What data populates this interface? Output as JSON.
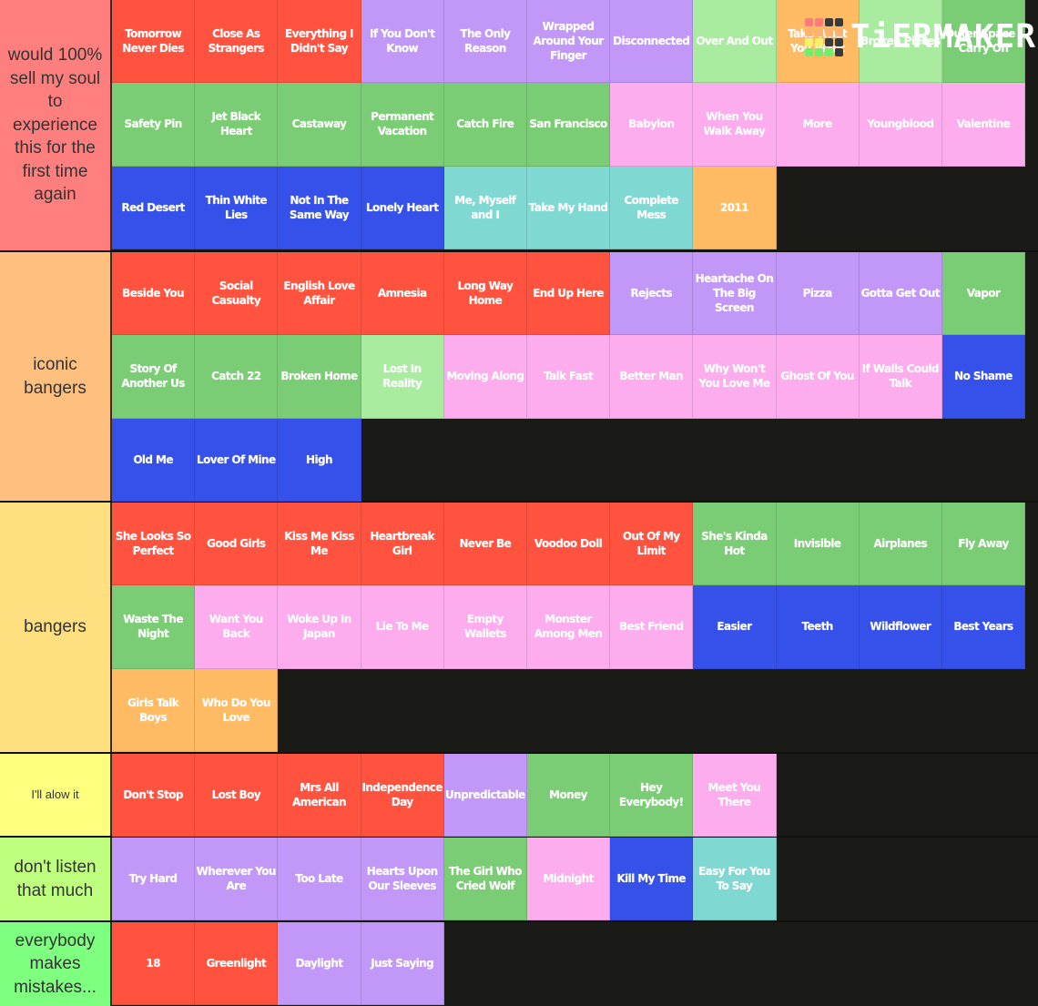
{
  "colors": {
    "red": "#ff5340",
    "purple": "#c198f7",
    "lightgreen": "#a9eca0",
    "green": "#7acd74",
    "orange": "#ffba64",
    "pink": "#fdacee",
    "blue": "#3650ea",
    "teal": "#80d8d2"
  },
  "logo": {
    "text": "TiERMAKER",
    "grid": [
      "#ff7a7a",
      "#ff7a7a",
      "#3a3a3a",
      "#3a3a3a",
      "#ffb36e",
      "#ffb36e",
      "#ffb36e",
      "#ffb36e",
      "#f7f06a",
      "#f7f06a",
      "#3a3a3a",
      "#3a3a3a",
      "#6ef06a",
      "#6ef06a",
      "#6ef06a",
      "#3a3a3a"
    ]
  },
  "tiers": [
    {
      "label": "would 100% sell my soul to experience this for the first time again",
      "color": "#ff7f7f",
      "rows": 3,
      "items": [
        {
          "name": "Tomorrow Never Dies",
          "c": "red"
        },
        {
          "name": "Close As Strangers",
          "c": "red"
        },
        {
          "name": "Everything I Didn't Say",
          "c": "red"
        },
        {
          "name": "If You Don't Know",
          "c": "purple"
        },
        {
          "name": "The Only Reason",
          "c": "purple"
        },
        {
          "name": "Wrapped Around Your Finger",
          "c": "purple"
        },
        {
          "name": "Disconnected",
          "c": "purple"
        },
        {
          "name": "Over And Out",
          "c": "lightgreen"
        },
        {
          "name": "Take What You Want",
          "c": "orange"
        },
        {
          "name": "Broken Pieces",
          "c": "lightgreen"
        },
        {
          "name": "Outer Space / Carry On",
          "c": "green"
        },
        {
          "name": "Safety Pin",
          "c": "green"
        },
        {
          "name": "Jet Black Heart",
          "c": "green"
        },
        {
          "name": "Castaway",
          "c": "green"
        },
        {
          "name": "Permanent Vacation",
          "c": "green"
        },
        {
          "name": "Catch Fire",
          "c": "green"
        },
        {
          "name": "San Francisco",
          "c": "green"
        },
        {
          "name": "Babylon",
          "c": "pink"
        },
        {
          "name": "When You Walk Away",
          "c": "pink"
        },
        {
          "name": "More",
          "c": "pink"
        },
        {
          "name": "Youngblood",
          "c": "pink"
        },
        {
          "name": "Valentine",
          "c": "pink"
        },
        {
          "name": "Red Desert",
          "c": "blue"
        },
        {
          "name": "Thin White Lies",
          "c": "blue"
        },
        {
          "name": "Not In The Same Way",
          "c": "blue"
        },
        {
          "name": "Lonely Heart",
          "c": "blue"
        },
        {
          "name": "Me, Myself and I",
          "c": "teal"
        },
        {
          "name": "Take My Hand",
          "c": "teal"
        },
        {
          "name": "Complete Mess",
          "c": "teal"
        },
        {
          "name": "2011",
          "c": "orange"
        }
      ]
    },
    {
      "label": "iconic bangers",
      "color": "#ffbf7f",
      "rows": 3,
      "items": [
        {
          "name": "Beside You",
          "c": "red"
        },
        {
          "name": "Social Casualty",
          "c": "red"
        },
        {
          "name": "English Love Affair",
          "c": "red"
        },
        {
          "name": "Amnesia",
          "c": "red"
        },
        {
          "name": "Long Way Home",
          "c": "red"
        },
        {
          "name": "End Up Here",
          "c": "red"
        },
        {
          "name": "Rejects",
          "c": "purple"
        },
        {
          "name": "Heartache On The Big Screen",
          "c": "purple"
        },
        {
          "name": "Pizza",
          "c": "purple"
        },
        {
          "name": "Gotta Get Out",
          "c": "purple"
        },
        {
          "name": "Vapor",
          "c": "green"
        },
        {
          "name": "Story Of Another Us",
          "c": "green"
        },
        {
          "name": "Catch 22",
          "c": "green"
        },
        {
          "name": "Broken Home",
          "c": "green"
        },
        {
          "name": "Lost In Reality",
          "c": "lightgreen"
        },
        {
          "name": "Moving Along",
          "c": "pink"
        },
        {
          "name": "Talk Fast",
          "c": "pink"
        },
        {
          "name": "Better Man",
          "c": "pink"
        },
        {
          "name": "Why Won't You Love Me",
          "c": "pink"
        },
        {
          "name": "Ghost Of You",
          "c": "pink"
        },
        {
          "name": "If Walls Could Talk",
          "c": "pink"
        },
        {
          "name": "No Shame",
          "c": "blue"
        },
        {
          "name": "Old Me",
          "c": "blue"
        },
        {
          "name": "Lover Of Mine",
          "c": "blue"
        },
        {
          "name": "High",
          "c": "blue"
        }
      ]
    },
    {
      "label": "bangers",
      "color": "#ffdf7f",
      "rows": 3,
      "items": [
        {
          "name": "She Looks So Perfect",
          "c": "red"
        },
        {
          "name": "Good Girls",
          "c": "red"
        },
        {
          "name": "Kiss Me Kiss Me",
          "c": "red"
        },
        {
          "name": "Heartbreak Girl",
          "c": "red"
        },
        {
          "name": "Never Be",
          "c": "red"
        },
        {
          "name": "Voodoo Doll",
          "c": "red"
        },
        {
          "name": "Out Of My Limit",
          "c": "red"
        },
        {
          "name": "She's Kinda Hot",
          "c": "green"
        },
        {
          "name": "Invisible",
          "c": "green"
        },
        {
          "name": "Airplanes",
          "c": "green"
        },
        {
          "name": "Fly Away",
          "c": "green"
        },
        {
          "name": "Waste The Night",
          "c": "green"
        },
        {
          "name": "Want You Back",
          "c": "pink"
        },
        {
          "name": "Woke Up In Japan",
          "c": "pink"
        },
        {
          "name": "Lie To Me",
          "c": "pink"
        },
        {
          "name": "Empty Wallets",
          "c": "pink"
        },
        {
          "name": "Monster Among Men",
          "c": "pink"
        },
        {
          "name": "Best Friend",
          "c": "pink"
        },
        {
          "name": "Easier",
          "c": "blue"
        },
        {
          "name": "Teeth",
          "c": "blue"
        },
        {
          "name": "Wildflower",
          "c": "blue"
        },
        {
          "name": "Best Years",
          "c": "blue"
        },
        {
          "name": "Girls Talk Boys",
          "c": "orange"
        },
        {
          "name": "Who Do You Love",
          "c": "orange"
        }
      ]
    },
    {
      "label": "I'll alow it",
      "color": "#ffff7f",
      "small": true,
      "rows": 1,
      "items": [
        {
          "name": "Don't Stop",
          "c": "red"
        },
        {
          "name": "Lost Boy",
          "c": "red"
        },
        {
          "name": "Mrs All American",
          "c": "red"
        },
        {
          "name": "Independence Day",
          "c": "red"
        },
        {
          "name": "Unpredictable",
          "c": "purple"
        },
        {
          "name": "Money",
          "c": "green"
        },
        {
          "name": "Hey Everybody!",
          "c": "green"
        },
        {
          "name": "Meet You There",
          "c": "pink"
        }
      ]
    },
    {
      "label": "don't listen that much",
      "color": "#bfff7f",
      "rows": 1,
      "items": [
        {
          "name": "Try Hard",
          "c": "purple"
        },
        {
          "name": "Wherever You Are",
          "c": "purple"
        },
        {
          "name": "Too Late",
          "c": "purple"
        },
        {
          "name": "Hearts Upon Our Sleeves",
          "c": "purple"
        },
        {
          "name": "The Girl Who Cried Wolf",
          "c": "green"
        },
        {
          "name": "Midnight",
          "c": "pink"
        },
        {
          "name": "Kill My Time",
          "c": "blue"
        },
        {
          "name": "Easy For You To Say",
          "c": "teal"
        }
      ]
    },
    {
      "label": "everybody makes mistakes...",
      "color": "#7fff7f",
      "rows": 1,
      "items": [
        {
          "name": "18",
          "c": "red"
        },
        {
          "name": "Greenlight",
          "c": "red"
        },
        {
          "name": "Daylight",
          "c": "purple"
        },
        {
          "name": "Just Saying",
          "c": "purple"
        }
      ]
    }
  ]
}
